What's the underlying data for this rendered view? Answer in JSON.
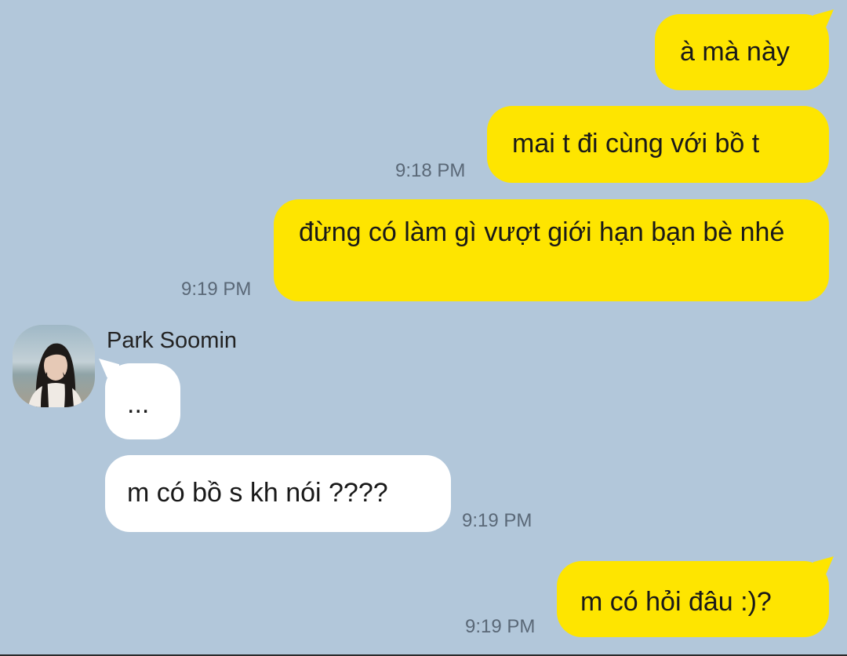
{
  "conversation": {
    "contact_name": "Park Soomin",
    "messages": [
      {
        "sender": "me",
        "text": "à mà này",
        "time": ""
      },
      {
        "sender": "me",
        "text": "mai t đi cùng với bồ t",
        "time": "9:18 PM"
      },
      {
        "sender": "me",
        "text": "đừng có làm gì vượt giới hạn bạn bè nhé",
        "time": "9:19 PM"
      },
      {
        "sender": "them",
        "text": "...",
        "time": ""
      },
      {
        "sender": "them",
        "text": "m có bồ s kh nói ????",
        "time": "9:19 PM"
      },
      {
        "sender": "me",
        "text": "m có hỏi đâu :)?",
        "time": "9:19 PM"
      }
    ]
  },
  "colors": {
    "background": "#b2c7da",
    "my_bubble": "#fee500",
    "their_bubble": "#ffffff",
    "timestamp": "#5a6877"
  }
}
